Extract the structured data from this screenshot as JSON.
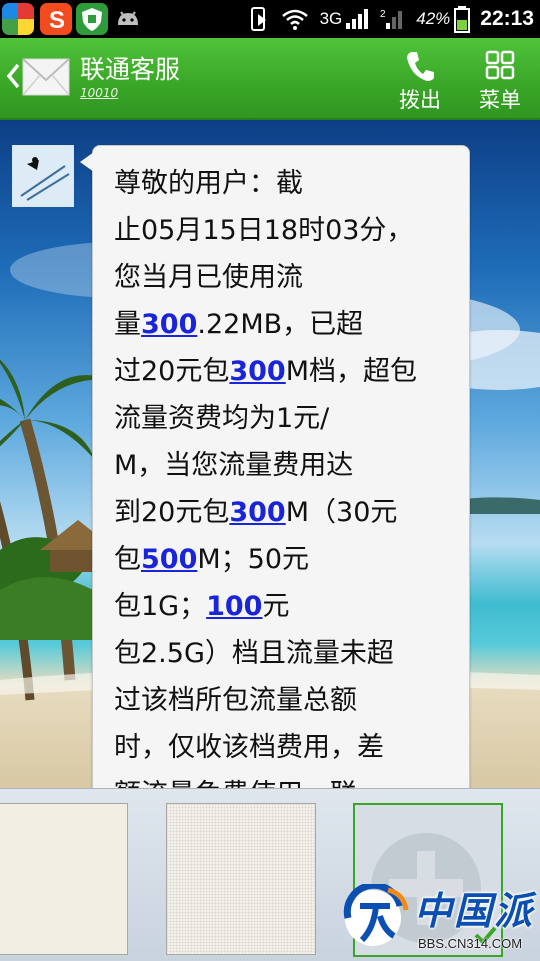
{
  "status_bar": {
    "app_icons": [
      "colorful-app-icon",
      "sogou-s-icon",
      "shield-app-icon",
      "android-icon"
    ],
    "network_label": "3G",
    "battery_percent": "42%",
    "time": "22:13"
  },
  "header": {
    "title": "联通客服",
    "number": "10010",
    "buttons": [
      {
        "label": "拨出",
        "icon": "phone-icon"
      },
      {
        "label": "菜单",
        "icon": "menu-grid-icon"
      }
    ]
  },
  "message": {
    "lines": [
      [
        {
          "t": "尊敬的用户：截"
        }
      ],
      [
        {
          "t": "止05月15日18时03分，"
        }
      ],
      [
        {
          "t": "您当月已使用流"
        }
      ],
      [
        {
          "t": "量"
        },
        {
          "t": "300",
          "link": true
        },
        {
          "t": ".22MB，已超"
        }
      ],
      [
        {
          "t": "过20元包"
        },
        {
          "t": "300",
          "link": true
        },
        {
          "t": "M档，超包"
        }
      ],
      [
        {
          "t": "流量资费均为1元/"
        }
      ],
      [
        {
          "t": "M，当您流量费用达"
        }
      ],
      [
        {
          "t": "到20元包"
        },
        {
          "t": "300",
          "link": true
        },
        {
          "t": "M（30元"
        }
      ],
      [
        {
          "t": "包"
        },
        {
          "t": "500",
          "link": true
        },
        {
          "t": "M；50元"
        }
      ],
      [
        {
          "t": "包1G；"
        },
        {
          "t": "100",
          "link": true
        },
        {
          "t": "元"
        }
      ],
      [
        {
          "t": "包2.5G）档且流量未超"
        }
      ],
      [
        {
          "t": "过该档所包流量总额"
        }
      ],
      [
        {
          "t": "时，仅收该档费用，差"
        }
      ],
      [
        {
          "t": "额流量免费使用。联"
        }
      ]
    ]
  },
  "theme_picker": {
    "cards": [
      "plain-theme",
      "grid-theme",
      "add-theme"
    ],
    "selected": "add-theme"
  },
  "watermark": {
    "text": "中国派",
    "url": "BBS.CN314.COM"
  },
  "colors": {
    "header_green": "#3aa627",
    "link_blue": "#1a24d8",
    "bubble_bg": "#f5f5f5"
  }
}
